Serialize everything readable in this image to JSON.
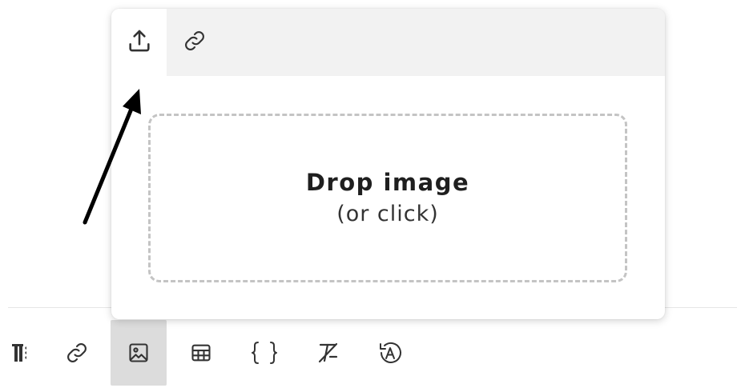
{
  "popup": {
    "tabs": [
      {
        "id": "upload",
        "icon": "upload-icon",
        "active": true
      },
      {
        "id": "link",
        "icon": "link-icon",
        "active": false
      }
    ],
    "dropzone": {
      "title": "Drop image",
      "subtitle": "(or click)"
    }
  },
  "toolbar": {
    "items": [
      {
        "icon": "paragraph-format-icon",
        "active": false
      },
      {
        "icon": "link-icon",
        "active": false
      },
      {
        "icon": "image-icon",
        "active": true
      },
      {
        "icon": "table-icon",
        "active": false
      },
      {
        "icon": "code-braces-icon",
        "active": false
      },
      {
        "icon": "clear-formatting-icon",
        "active": false
      },
      {
        "icon": "spellcheck-icon",
        "active": false
      }
    ]
  },
  "colors": {
    "icon": "#333333",
    "tab_bar": "#f2f2f2",
    "active_toolbar_button": "#dcdcdc",
    "dropzone_border": "#c4c4c4",
    "annotation_arrow": "#000000"
  }
}
